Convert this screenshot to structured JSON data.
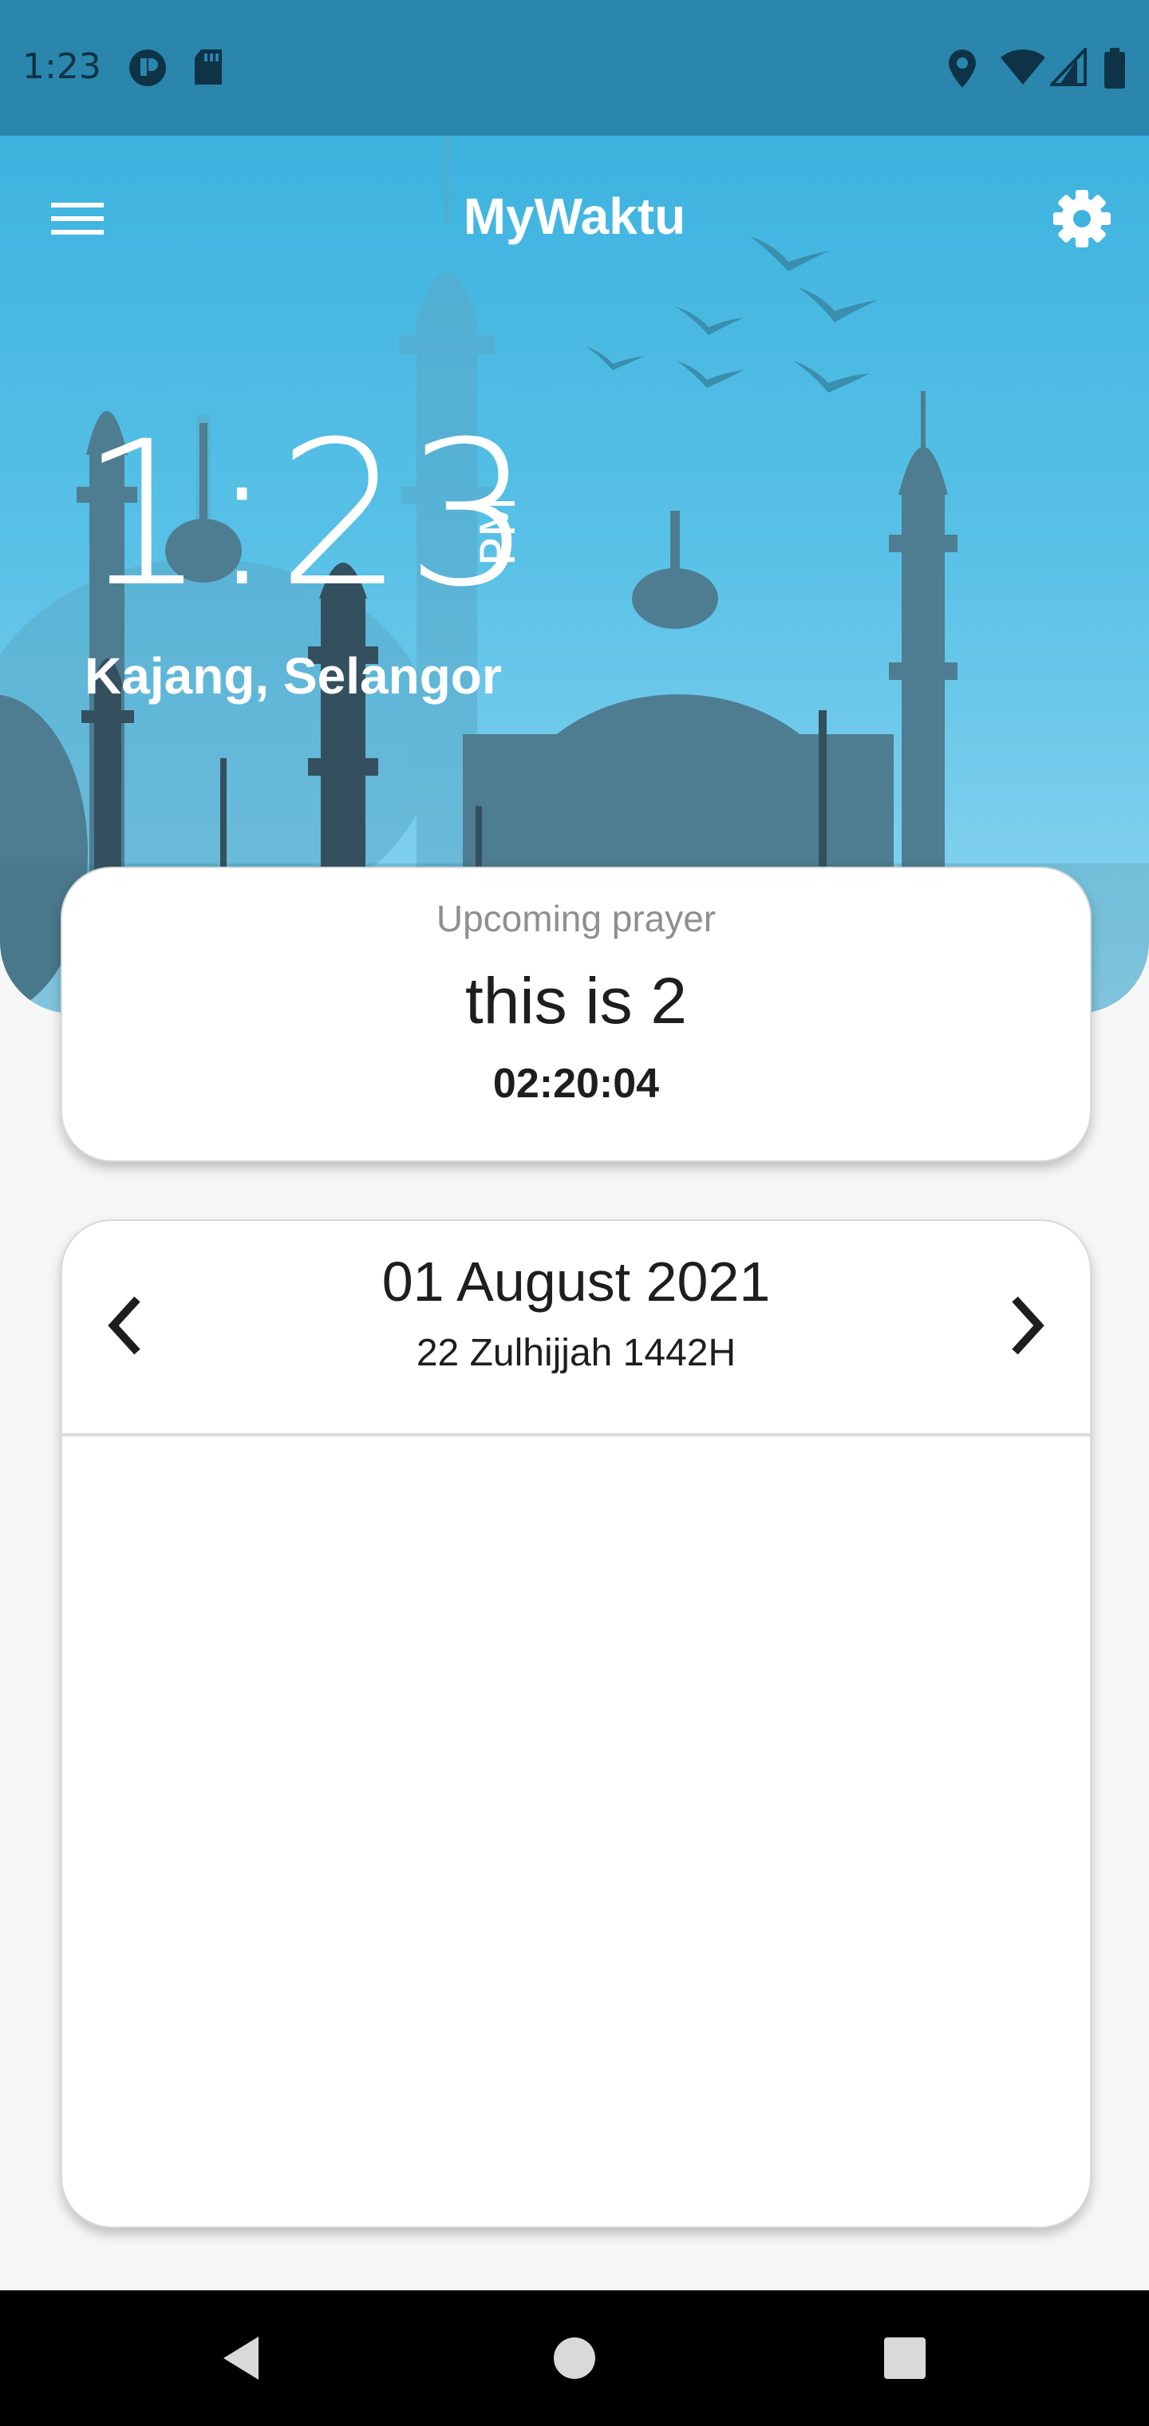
{
  "status_bar": {
    "time": "1:23",
    "icons": [
      "notification-icon",
      "sd-card-icon",
      "location-icon",
      "wifi-icon",
      "signal-icon",
      "battery-icon"
    ]
  },
  "header": {
    "title": "MyWaktu",
    "menu_icon": "hamburger-menu-icon",
    "settings_icon": "gear-icon"
  },
  "hero": {
    "time": "1:23",
    "ampm": "PM",
    "location": "Kajang, Selangor"
  },
  "upcoming_prayer": {
    "label": "Upcoming prayer",
    "name": "this is 2",
    "countdown": "02:20:04"
  },
  "date_card": {
    "gregorian": "01 August 2021",
    "hijri": "22 Zulhijjah 1442H",
    "prev_icon": "chevron-left-icon",
    "next_icon": "chevron-right-icon"
  },
  "nav_bar": {
    "icons": [
      "back-icon",
      "home-icon",
      "recents-icon"
    ]
  },
  "colors": {
    "status_bar": "#2a86ad",
    "hero_top": "#3db3df",
    "hero_bottom": "#8fd6f0",
    "mosque_silhouette": "#2f5b6d"
  }
}
